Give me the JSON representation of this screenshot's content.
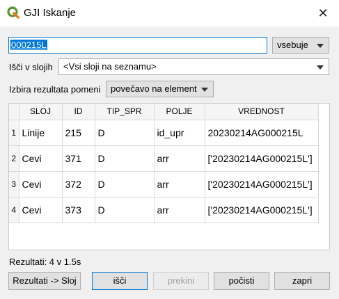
{
  "window": {
    "title": "GJI Iskanje",
    "app_icon": "qgis-logo-icon",
    "close_icon": "close-icon"
  },
  "search": {
    "value": "000215L",
    "match_mode": "vsebuje"
  },
  "layers": {
    "label": "Išči v slojih",
    "selected": "<Vsi sloji na seznamu>"
  },
  "result_action": {
    "label": "Izbira rezultata pomeni",
    "selected": "povečavo na element"
  },
  "table": {
    "columns": [
      "SLOJ",
      "ID",
      "TIP_SPR",
      "POLJE",
      "VREDNOST"
    ],
    "rows": [
      {
        "num": "1",
        "cells": [
          "Linije",
          "215",
          "D",
          "id_upr",
          "20230214AG000215L"
        ]
      },
      {
        "num": "2",
        "cells": [
          "Cevi",
          "371",
          "D",
          "arr",
          "['20230214AG000215L']"
        ]
      },
      {
        "num": "3",
        "cells": [
          "Cevi",
          "372",
          "D",
          "arr",
          "['20230214AG000215L']"
        ]
      },
      {
        "num": "4",
        "cells": [
          "Cevi",
          "373",
          "D",
          "arr",
          "['20230214AG000215L']"
        ]
      }
    ]
  },
  "status": {
    "text": "Rezultati: 4 v 1.5s"
  },
  "buttons": {
    "export": "Rezultati -> Sloj",
    "search": "išči",
    "stop": "prekini",
    "clear": "počisti",
    "close": "zapri"
  },
  "colors": {
    "accent": "#0078d7",
    "qgis_green": "#589632",
    "qgis_yellow": "#ee7913"
  }
}
